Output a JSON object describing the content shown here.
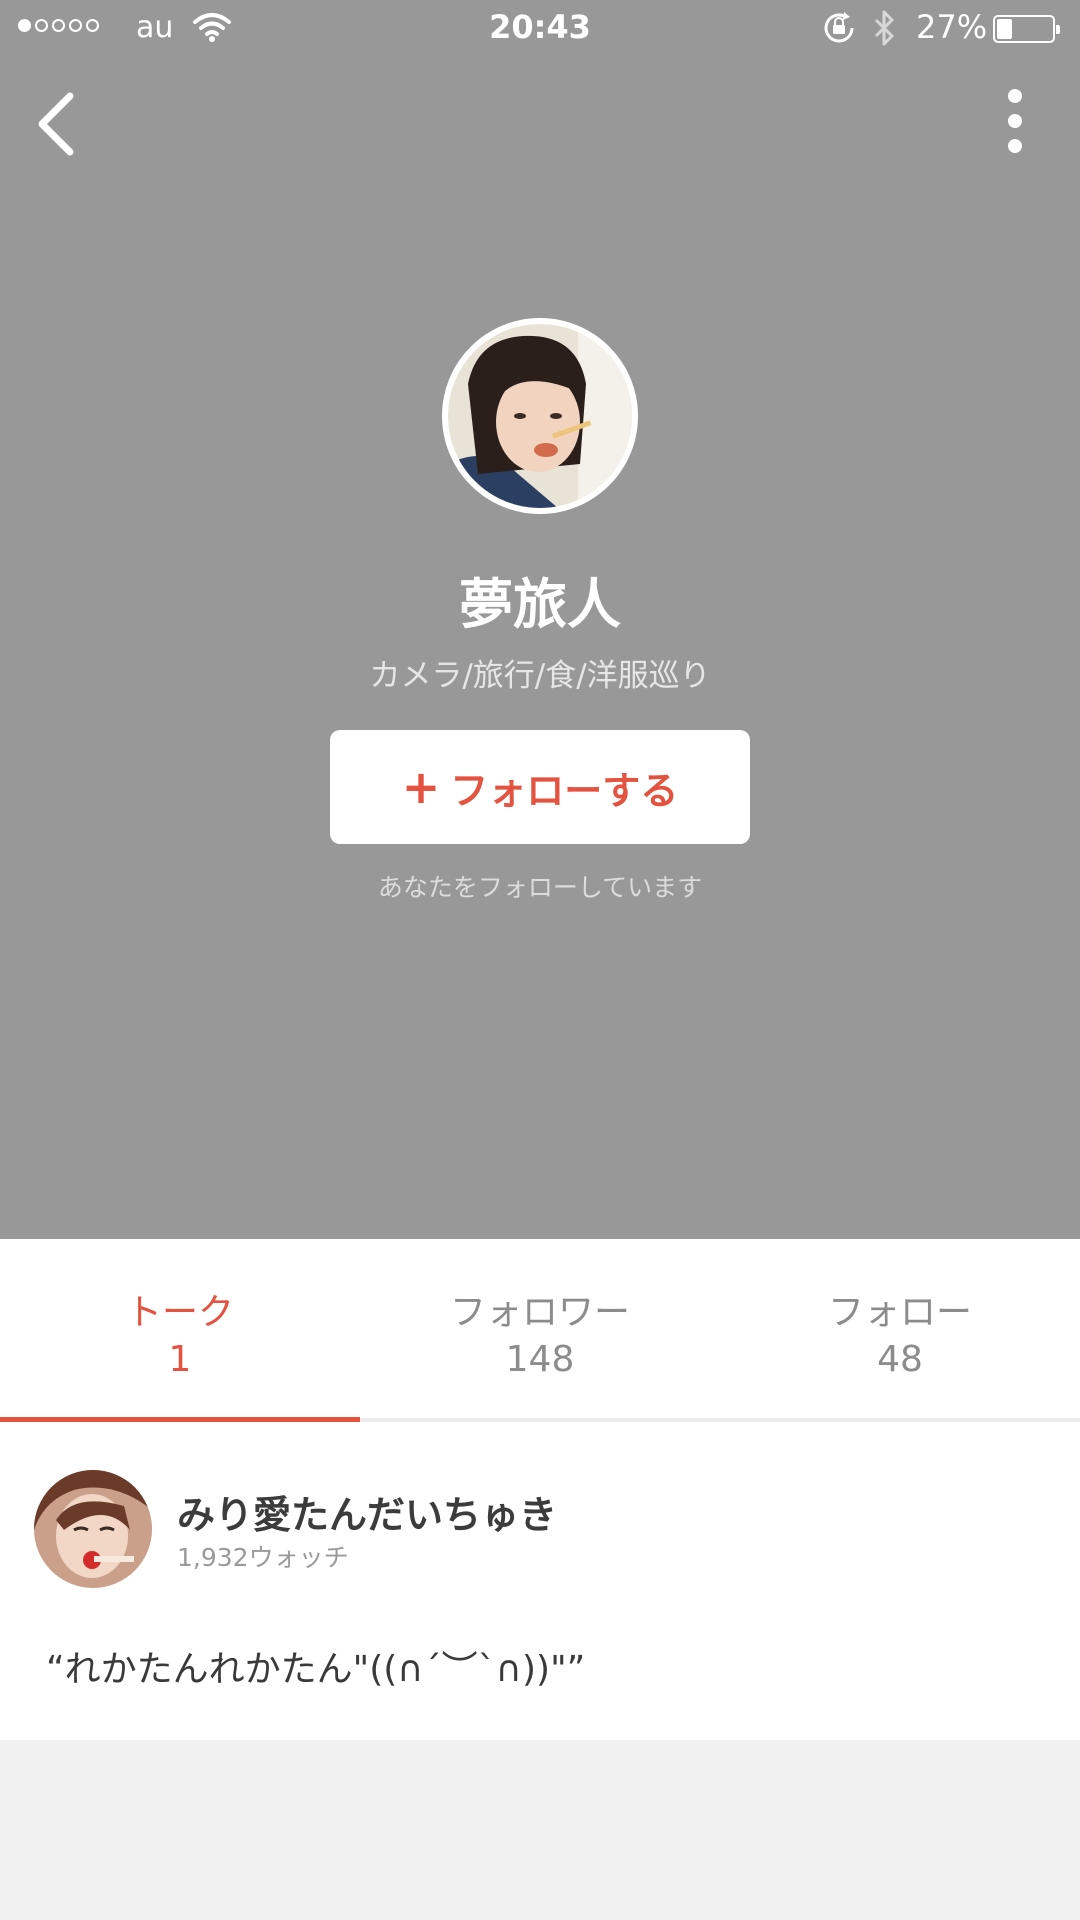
{
  "status_bar": {
    "carrier": "au",
    "time": "20:43",
    "battery_percent": "27%",
    "battery_level": 0.27,
    "signal_bars": 1,
    "signal_total": 5
  },
  "header": {
    "back_icon": "chevron-left-icon",
    "more_icon": "vertical-dots-icon",
    "background": "#989898"
  },
  "profile": {
    "name": "夢旅人",
    "bio": "カメラ/旅行/食/洋服巡り",
    "follow_button": "フォローする",
    "follow_icon": "plus-icon",
    "follows_you_text": "あなたをフォローしています"
  },
  "tabs": [
    {
      "label": "トーク",
      "count": "1",
      "active": true
    },
    {
      "label": "フォロワー",
      "count": "148",
      "active": false
    },
    {
      "label": "フォロー",
      "count": "48",
      "active": false
    }
  ],
  "talks": [
    {
      "title": "みり愛たんだいちゅき",
      "watch_count": "1,932ウォッチ",
      "quote": "“れかたんれかたん\"((∩´︶`∩))\"”"
    }
  ],
  "colors": {
    "accent": "#e3533f",
    "header_bg": "#989898",
    "page_bg": "#f1f1f1"
  }
}
